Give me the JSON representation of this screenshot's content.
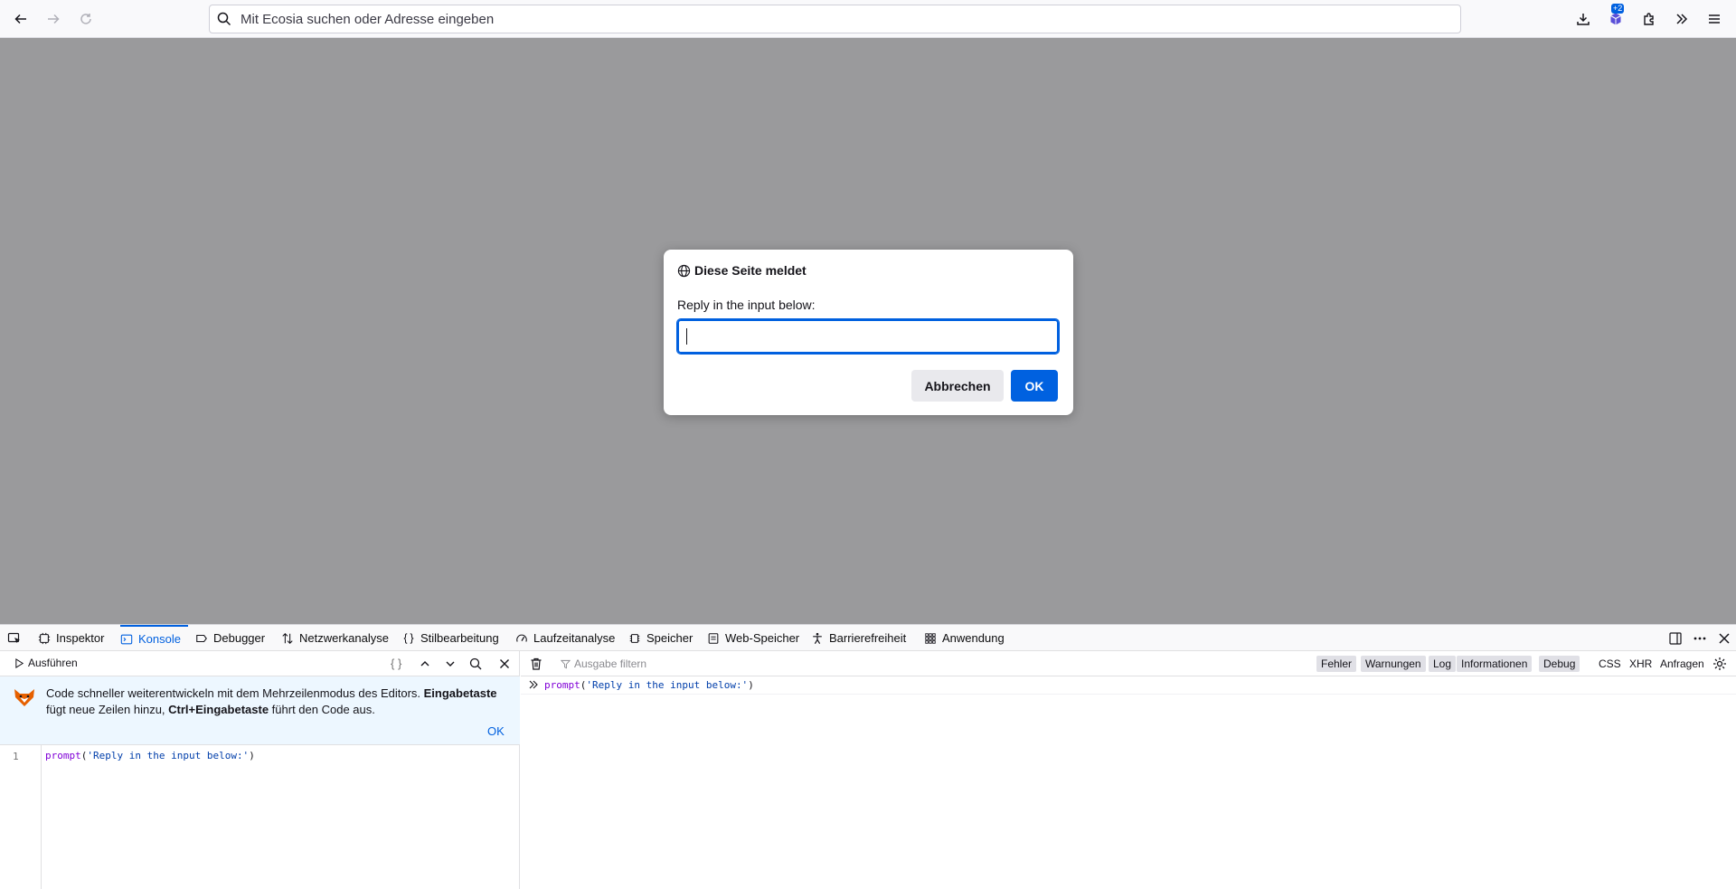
{
  "browser": {
    "url_placeholder": "Mit Ecosia suchen oder Adresse eingeben",
    "extension_badge": "+2"
  },
  "dialog": {
    "title": "Diese Seite meldet",
    "message": "Reply in the input below:",
    "input_value": "",
    "cancel_label": "Abbrechen",
    "ok_label": "OK"
  },
  "devtools": {
    "tabs": [
      {
        "label": "Inspektor",
        "icon": "inspector-icon"
      },
      {
        "label": "Konsole",
        "icon": "console-icon",
        "active": true
      },
      {
        "label": "Debugger",
        "icon": "debugger-icon"
      },
      {
        "label": "Netzwerkanalyse",
        "icon": "network-icon"
      },
      {
        "label": "Stilbearbeitung",
        "icon": "style-editor-icon"
      },
      {
        "label": "Laufzeitanalyse",
        "icon": "performance-icon"
      },
      {
        "label": "Speicher",
        "icon": "memory-icon"
      },
      {
        "label": "Web-Speicher",
        "icon": "storage-icon"
      },
      {
        "label": "Barrierefreiheit",
        "icon": "accessibility-icon"
      },
      {
        "label": "Anwendung",
        "icon": "application-icon"
      }
    ],
    "editor": {
      "run_label": "Ausführen",
      "pretty_print_label": "{ }",
      "notice": {
        "text_1": "Code schneller weiterentwickeln mit dem Mehrzeilenmodus des Editors. ",
        "bold_1": "Eingabetaste",
        "text_2": " fügt neue Zeilen hinzu, ",
        "bold_2": "Ctrl+Eingabetaste",
        "text_3": " führt den Code aus.",
        "ok_label": "OK"
      },
      "line_number": "1",
      "code_fn": "prompt",
      "code_paren_open": "(",
      "code_string": "'Reply in the input below:'",
      "code_paren_close": ")"
    },
    "output": {
      "filter_placeholder": "Ausgabe filtern",
      "filters": [
        {
          "label": "Fehler",
          "on": true
        },
        {
          "label": "Warnungen",
          "on": true
        },
        {
          "label": "Log",
          "on": true
        },
        {
          "label": "Informationen",
          "on": true
        },
        {
          "label": "Debug",
          "on": true
        },
        {
          "label": "CSS",
          "on": false
        },
        {
          "label": "XHR",
          "on": false
        },
        {
          "label": "Anfragen",
          "on": false
        }
      ],
      "entry_fn": "prompt",
      "entry_paren_open": "(",
      "entry_string": "'Reply in the input below:'",
      "entry_paren_close": ")"
    }
  },
  "colors": {
    "accent": "#0060df",
    "page_overlay": "#9a9a9c",
    "notice_bg": "#edf7ff"
  }
}
